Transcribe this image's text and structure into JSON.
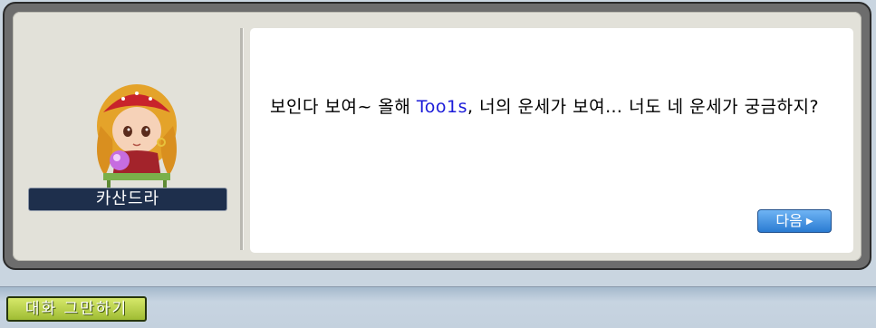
{
  "npc": {
    "name": "카산드라",
    "portrait_icon": "fortune-teller-npc-portrait"
  },
  "dialog": {
    "text_before": "보인다 보여~ 올해 ",
    "player_name": "Too1s",
    "text_after": ", 너의 운세가 보여… 너도 네 운세가 궁금하지?",
    "player_name_color": "#1b1bd9"
  },
  "buttons": {
    "next_label": "다음",
    "next_icon": "right-triangle-icon",
    "end_chat_label": "대화 그만하기"
  },
  "colors": {
    "frame": "#6d6d6d",
    "panel_bg": "#e2e1d9",
    "name_plate": "#1e2f4c",
    "next_button": "#2a7bd2",
    "end_chat_button": "#9fbc33"
  }
}
